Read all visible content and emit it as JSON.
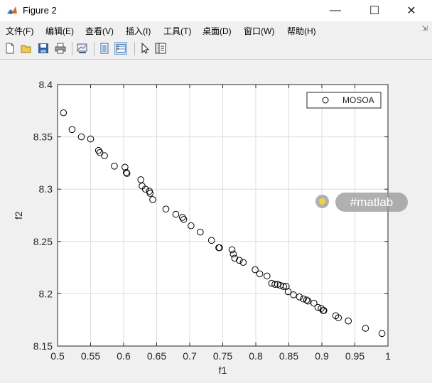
{
  "window": {
    "title": "Figure 2",
    "minimize": "—",
    "maximize": "☐",
    "close": "✕"
  },
  "menu": [
    "文件(F)",
    "编辑(E)",
    "查看(V)",
    "插入(I)",
    "工具(T)",
    "桌面(D)",
    "窗口(W)",
    "帮助(H)"
  ],
  "toolbar": [
    "new-icon",
    "open-icon",
    "save-icon",
    "print-icon",
    "link-plot-icon",
    "hide-plot-tools-icon",
    "show-plot-tools-icon",
    "edit-plot-arrow-icon",
    "property-inspector-icon"
  ],
  "watermark": {
    "label": "#matlab"
  },
  "chart_data": {
    "type": "scatter",
    "title": "",
    "xlabel": "f1",
    "ylabel": "f2",
    "xlim": [
      0.5,
      1
    ],
    "ylim": [
      8.15,
      8.4
    ],
    "xticks": [
      "0.5",
      "0.55",
      "0.6",
      "0.65",
      "0.7",
      "0.75",
      "0.8",
      "0.85",
      "0.9",
      "0.95",
      "1"
    ],
    "yticks": [
      "8.15",
      "8.2",
      "8.25",
      "8.3",
      "8.35",
      "8.4"
    ],
    "grid": true,
    "legend_position": "top-right",
    "marker": "circle",
    "marker_color": "#000000",
    "series": [
      {
        "name": "MOSOA",
        "points": [
          [
            0.509,
            8.373
          ],
          [
            0.522,
            8.357
          ],
          [
            0.536,
            8.35
          ],
          [
            0.55,
            8.348
          ],
          [
            0.562,
            8.337
          ],
          [
            0.564,
            8.335
          ],
          [
            0.571,
            8.332
          ],
          [
            0.586,
            8.322
          ],
          [
            0.602,
            8.321
          ],
          [
            0.604,
            8.316
          ],
          [
            0.605,
            8.315
          ],
          [
            0.626,
            8.309
          ],
          [
            0.628,
            8.303
          ],
          [
            0.633,
            8.3
          ],
          [
            0.639,
            8.298
          ],
          [
            0.64,
            8.296
          ],
          [
            0.644,
            8.29
          ],
          [
            0.664,
            8.281
          ],
          [
            0.679,
            8.276
          ],
          [
            0.689,
            8.273
          ],
          [
            0.691,
            8.271
          ],
          [
            0.702,
            8.265
          ],
          [
            0.716,
            8.259
          ],
          [
            0.733,
            8.251
          ],
          [
            0.744,
            8.244
          ],
          [
            0.745,
            8.244
          ],
          [
            0.764,
            8.242
          ],
          [
            0.766,
            8.238
          ],
          [
            0.768,
            8.234
          ],
          [
            0.775,
            8.232
          ],
          [
            0.781,
            8.23
          ],
          [
            0.799,
            8.223
          ],
          [
            0.806,
            8.219
          ],
          [
            0.817,
            8.217
          ],
          [
            0.824,
            8.21
          ],
          [
            0.829,
            8.209
          ],
          [
            0.833,
            8.209
          ],
          [
            0.837,
            8.208
          ],
          [
            0.842,
            8.207
          ],
          [
            0.846,
            8.207
          ],
          [
            0.849,
            8.202
          ],
          [
            0.857,
            8.199
          ],
          [
            0.866,
            8.197
          ],
          [
            0.872,
            8.195
          ],
          [
            0.877,
            8.194
          ],
          [
            0.879,
            8.193
          ],
          [
            0.888,
            8.191
          ],
          [
            0.894,
            8.187
          ],
          [
            0.899,
            8.186
          ],
          [
            0.902,
            8.184
          ],
          [
            0.903,
            8.184
          ],
          [
            0.921,
            8.179
          ],
          [
            0.925,
            8.177
          ],
          [
            0.94,
            8.174
          ],
          [
            0.966,
            8.167
          ],
          [
            0.991,
            8.162
          ]
        ]
      }
    ]
  }
}
